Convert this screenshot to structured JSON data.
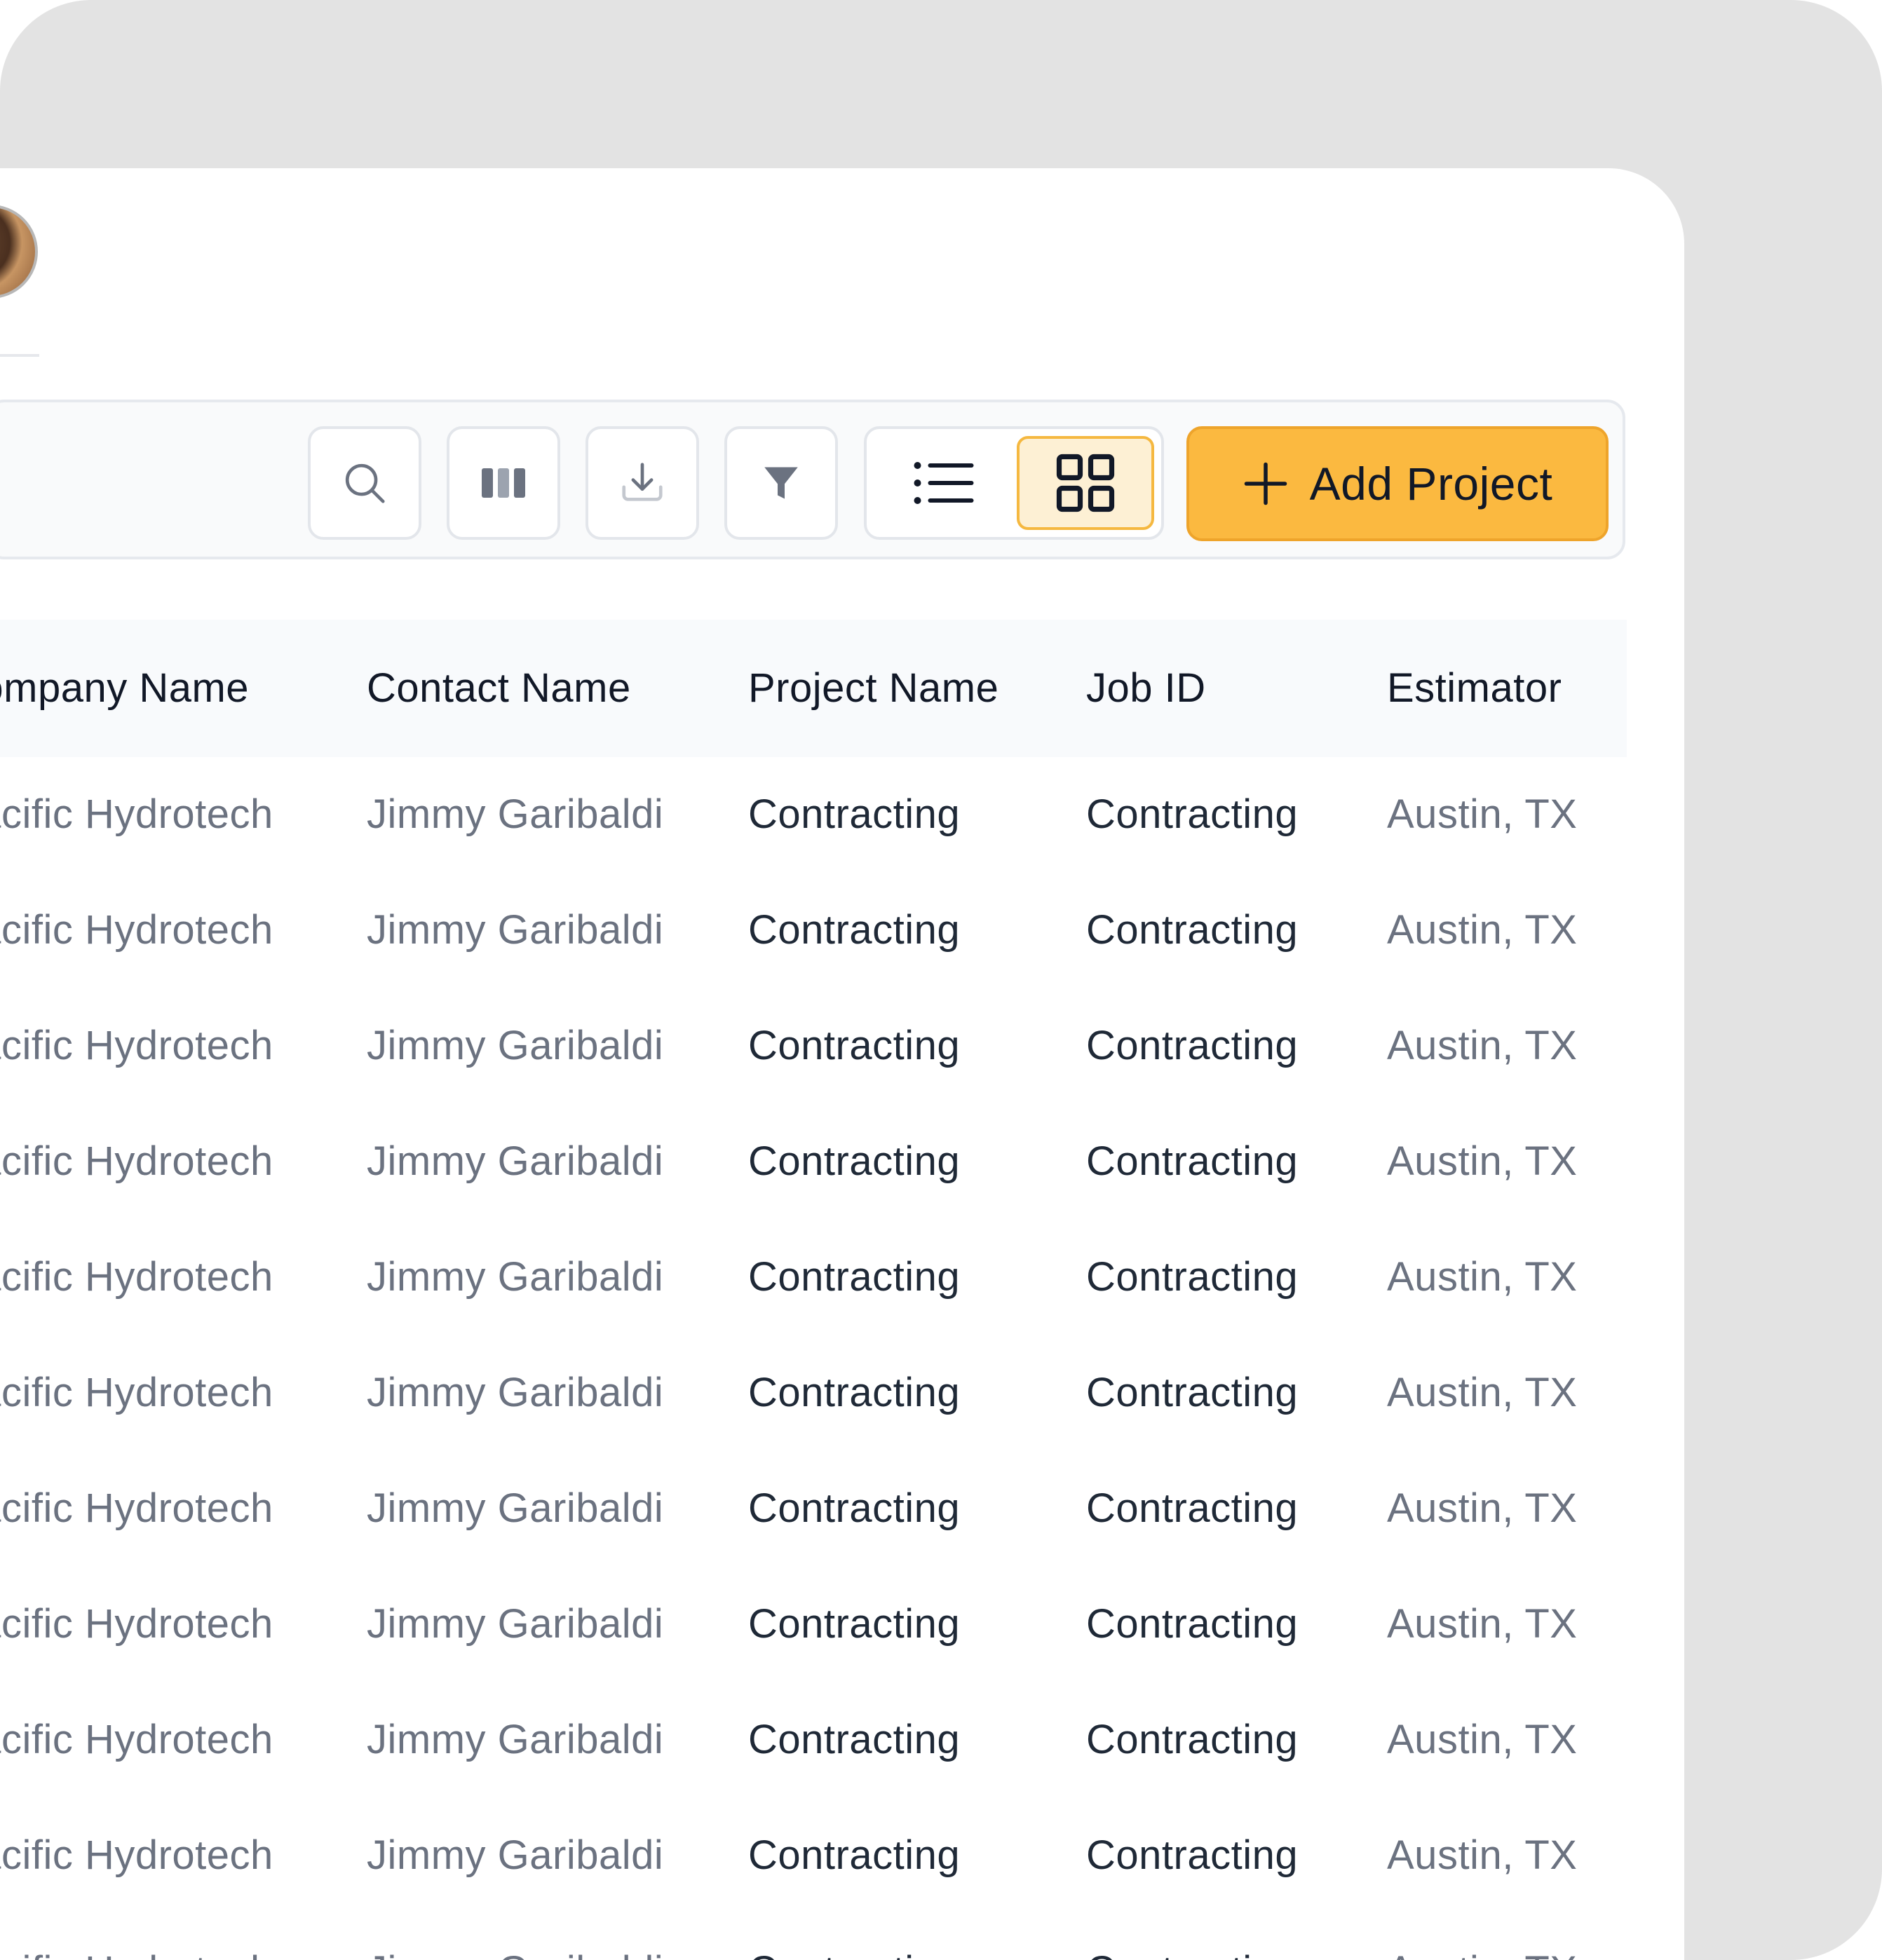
{
  "toolbar": {
    "buttons": [
      {
        "icon": "search-icon"
      },
      {
        "icon": "columns-icon"
      },
      {
        "icon": "download-icon"
      },
      {
        "icon": "filter-icon"
      }
    ],
    "view_toggle": {
      "list_icon": "list-view-icon",
      "grid_icon": "grid-view-icon",
      "selected": "grid"
    },
    "add_button_label": "Add Project"
  },
  "table": {
    "headers": [
      "Company Name",
      "Contact Name",
      "Project Name",
      "Job ID",
      "Estimator"
    ],
    "rows": [
      [
        "Pacific Hydrotech",
        "Jimmy Garibaldi",
        "Contracting",
        "Contracting",
        "Austin, TX"
      ],
      [
        "Pacific Hydrotech",
        "Jimmy Garibaldi",
        "Contracting",
        "Contracting",
        "Austin, TX"
      ],
      [
        "Pacific Hydrotech",
        "Jimmy Garibaldi",
        "Contracting",
        "Contracting",
        "Austin, TX"
      ],
      [
        "Pacific Hydrotech",
        "Jimmy Garibaldi",
        "Contracting",
        "Contracting",
        "Austin, TX"
      ],
      [
        "Pacific Hydrotech",
        "Jimmy Garibaldi",
        "Contracting",
        "Contracting",
        "Austin, TX"
      ],
      [
        "Pacific Hydrotech",
        "Jimmy Garibaldi",
        "Contracting",
        "Contracting",
        "Austin, TX"
      ],
      [
        "Pacific Hydrotech",
        "Jimmy Garibaldi",
        "Contracting",
        "Contracting",
        "Austin, TX"
      ],
      [
        "Pacific Hydrotech",
        "Jimmy Garibaldi",
        "Contracting",
        "Contracting",
        "Austin, TX"
      ],
      [
        "Pacific Hydrotech",
        "Jimmy Garibaldi",
        "Contracting",
        "Contracting",
        "Austin, TX"
      ],
      [
        "Pacific Hydrotech",
        "Jimmy Garibaldi",
        "Contracting",
        "Contracting",
        "Austin, TX"
      ],
      [
        "Pacific Hydrotech",
        "Jimmy Garibaldi",
        "Contracting",
        "Contracting",
        "Austin, TX"
      ]
    ]
  },
  "colors": {
    "accent": "#fbb940",
    "accent_border": "#eea42b",
    "toggle_selected_bg": "#fdf0d4",
    "outer_bg": "#e3e3e3",
    "header_bg": "#f8fafc",
    "text_primary": "#1f2937",
    "text_muted": "#6b7280"
  }
}
